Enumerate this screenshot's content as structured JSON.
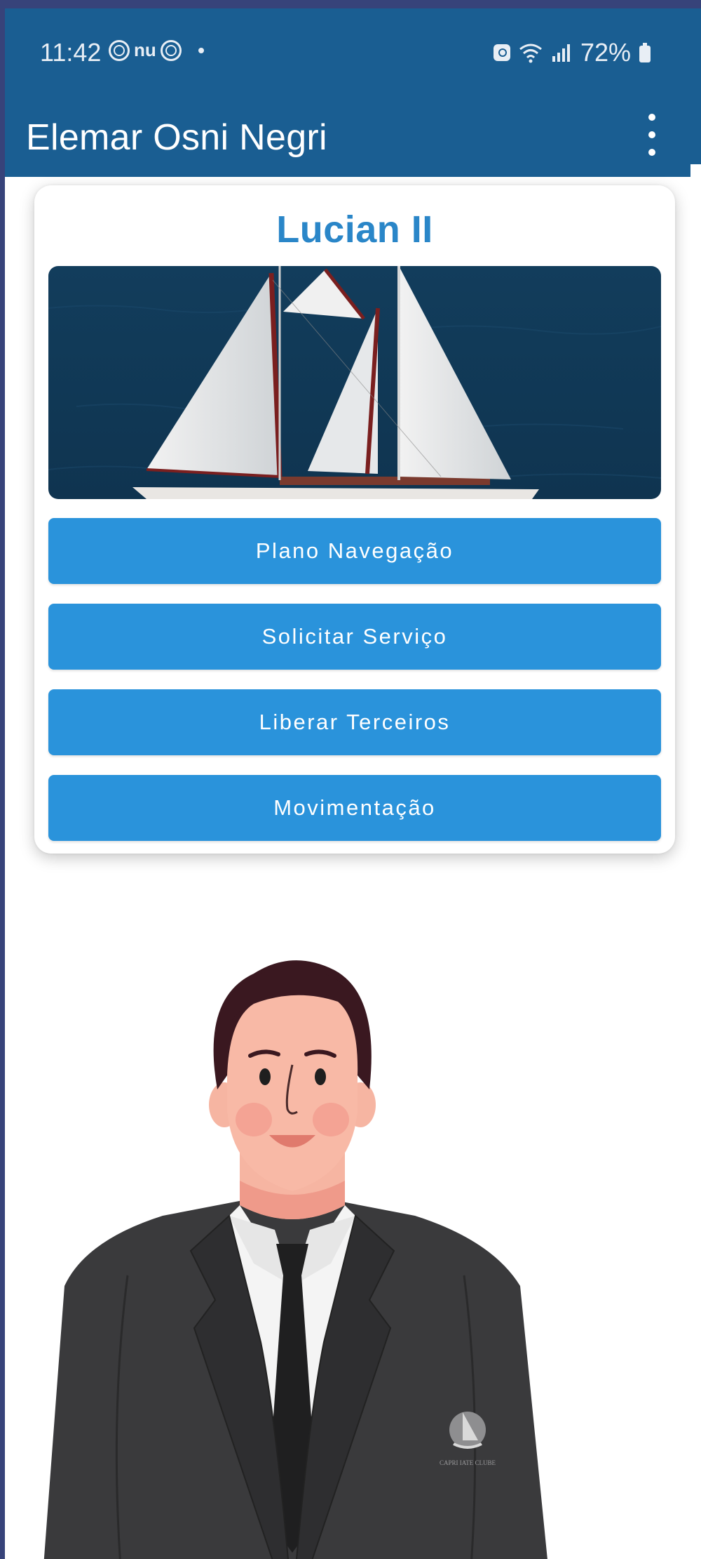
{
  "status_bar": {
    "time": "11:42",
    "carrier_glyph": "nu",
    "battery": "72%",
    "icons": [
      "alarm-icon",
      "wifi-icon",
      "signal-icon",
      "battery-icon"
    ]
  },
  "app_bar": {
    "title": "Elemar Osni Negri",
    "menu_icon": "more-vert-icon"
  },
  "boat_card": {
    "name": "Lucian II",
    "buttons": [
      {
        "label": "Plano Navegação"
      },
      {
        "label": "Solicitar Serviço"
      },
      {
        "label": "Liberar Terceiros"
      },
      {
        "label": "Movimentação"
      }
    ]
  },
  "avatar": {
    "emblem_text": "CAPRI IATE CLUBE"
  },
  "colors": {
    "app_bar": "#1a5e92",
    "button": "#2a93db",
    "boat_name": "#2a86c8",
    "frame": "#37437a"
  }
}
